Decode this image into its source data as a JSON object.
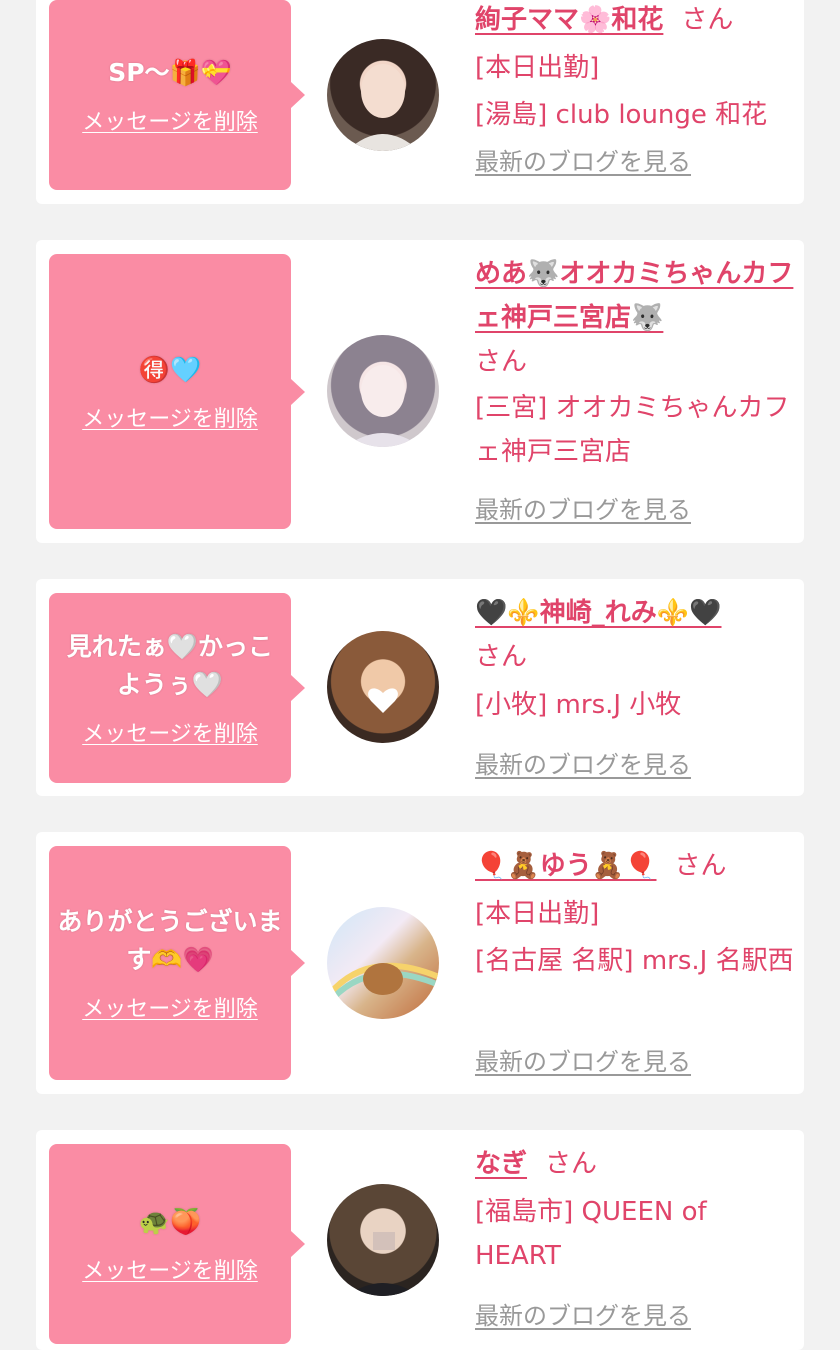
{
  "colors": {
    "accent": "#e0446a",
    "bubble": "#fa8ca4",
    "link_gray": "#999999",
    "background": "#f2f2f2"
  },
  "delete_label": "メッセージを削除",
  "blog_label": "最新のブログを見る",
  "honorific": "さん",
  "cards": [
    {
      "message": "SP〜🎁💝",
      "name": "絢子ママ🌸和花",
      "lines": [
        "[本日出勤]",
        "[湯島] club lounge 和花"
      ]
    },
    {
      "message": "🉐🩵",
      "name": "めあ🐺オオカミちゃんカフェ神戸三宮店🐺",
      "lines": [
        "[三宮] オオカミちゃんカフェ神戸三宮店"
      ]
    },
    {
      "message": "見れたぁ🤍かっこようぅ🤍",
      "name": "🖤⚜️神崎_れみ⚜️🖤",
      "lines": [
        "[小牧] mrs.J 小牧"
      ]
    },
    {
      "message": "ありがとうございます🫶💗",
      "name": "🎈🧸ゆう🧸🎈",
      "lines": [
        "[本日出勤]",
        "[名古屋 名駅] mrs.J 名駅西"
      ]
    },
    {
      "message": "🐢🍑",
      "name": "なぎ",
      "lines": [
        "[福島市] QUEEN of HEART"
      ]
    }
  ]
}
